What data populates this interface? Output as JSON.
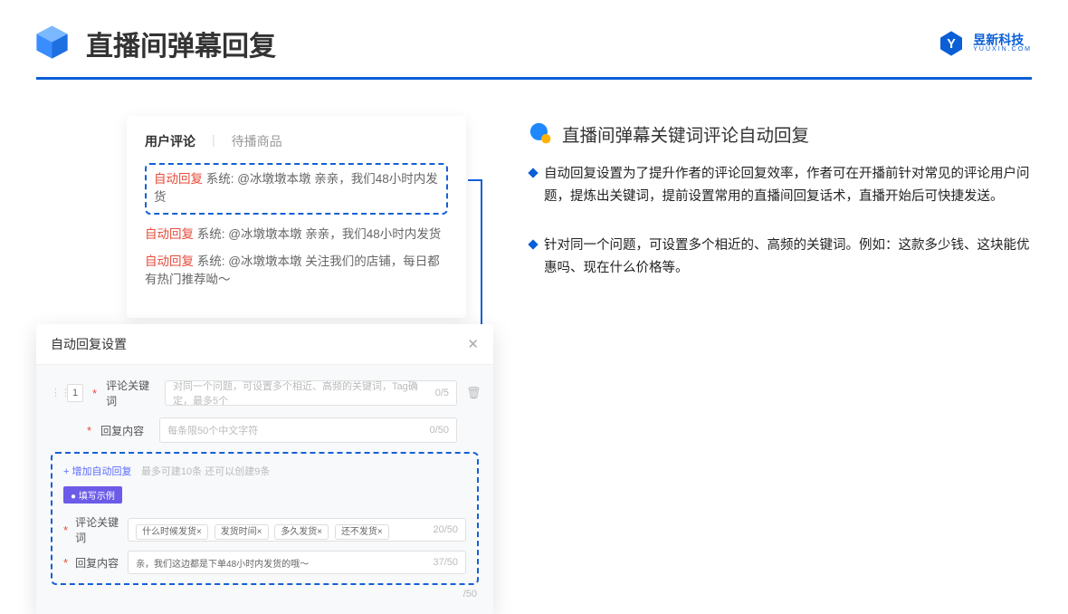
{
  "header": {
    "title": "直播间弹幕回复",
    "brand_cn": "昱新科技",
    "brand_en": "YUUXIN.COM"
  },
  "comments": {
    "tab_active": "用户评论",
    "tab_other": "待播商品",
    "items": [
      {
        "tag": "自动回复",
        "body": " 系统: @冰墩墩本墩 亲亲，我们48小时内发货"
      },
      {
        "tag": "自动回复",
        "body": " 系统: @冰墩墩本墩 亲亲，我们48小时内发货"
      },
      {
        "tag": "自动回复",
        "body": " 系统: @冰墩墩本墩 关注我们的店铺，每日都有热门推荐呦～"
      }
    ]
  },
  "modal": {
    "title": "自动回复设置",
    "order": "1",
    "label_keyword": "评论关键词",
    "ph_keyword": "对同一个问题，可设置多个相近、高频的关键词，Tag确定，最多5个",
    "count_keyword": "0/5",
    "label_content": "回复内容",
    "ph_content": "每条限50个中文字符",
    "count_content": "0/50",
    "count_outer": "/50",
    "add_text": "+ 增加自动回复",
    "add_sub": "最多可建10条 还可以创建9条",
    "pill": "● 填写示例",
    "example_label_kw": "评论关键词",
    "example_tags": [
      "什么时候发货×",
      "发货时间×",
      "多久发货×",
      "还不发货×"
    ],
    "example_kw_count": "20/50",
    "example_label_ct": "回复内容",
    "example_ct_text": "亲，我们这边都是下单48小时内发货的哦～",
    "example_ct_count": "37/50"
  },
  "right": {
    "section_title": "直播间弹幕关键词评论自动回复",
    "bullets": [
      "自动回复设置为了提升作者的评论回复效率，作者可在开播前针对常见的评论用户问题，提炼出关键词，提前设置常用的直播间回复话术，直播开始后可快捷发送。",
      "针对同一个问题，可设置多个相近的、高频的关键词。例如：这款多少钱、这块能优惠吗、现在什么价格等。"
    ]
  }
}
